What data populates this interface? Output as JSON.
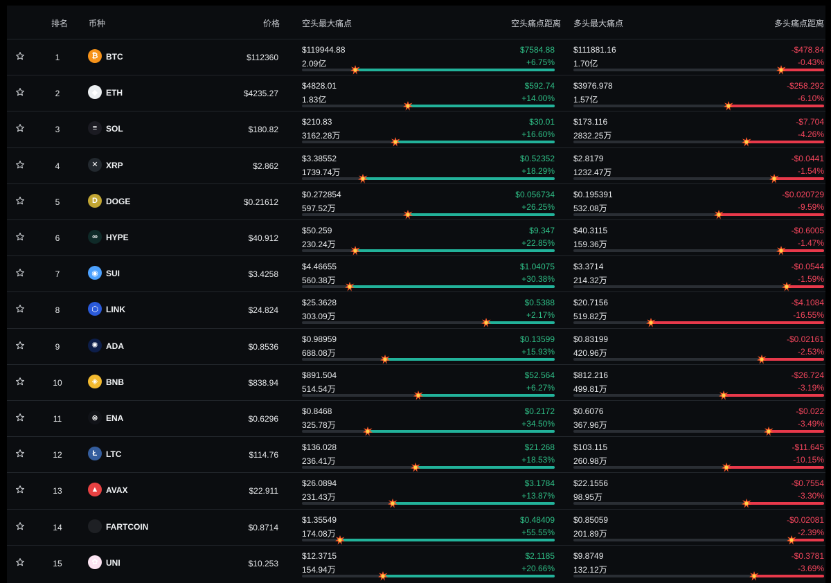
{
  "header": {
    "rank": "排名",
    "coin": "币种",
    "price": "价格",
    "short_max_pain": "空头最大痛点",
    "short_pain_distance": "空头痛点距离",
    "long_max_pain": "多头最大痛点",
    "long_pain_distance": "多头痛点距离"
  },
  "colors": {
    "positive": "#2ebd85",
    "negative": "#f6465d",
    "short_bar": "#22b29a",
    "long_bar": "#e8394b",
    "track": "#2a2e34",
    "background": "#0b0d10"
  },
  "rows": [
    {
      "rank": "1",
      "coin": "BTC",
      "icon": "bitcoin-icon",
      "icon_glyph": "₿",
      "icon_color": "#f7931a",
      "price": "$112360",
      "short_max": "$119944.88",
      "short_amt": "2.09亿",
      "short_dist": "$7584.88",
      "short_pct": "+6.75%",
      "short_fill": 0.79,
      "long_max": "$111881.16",
      "long_amt": "1.70亿",
      "long_dist": "-$478.84",
      "long_pct": "-0.43%",
      "long_fill": 0.17
    },
    {
      "rank": "2",
      "coin": "ETH",
      "icon": "ethereum-icon",
      "icon_glyph": "◆",
      "icon_color": "#eceff1",
      "price": "$4235.27",
      "short_max": "$4828.01",
      "short_amt": "1.83亿",
      "short_dist": "$592.74",
      "short_pct": "+14.00%",
      "short_fill": 0.58,
      "long_max": "$3976.978",
      "long_amt": "1.57亿",
      "long_dist": "-$258.292",
      "long_pct": "-6.10%",
      "long_fill": 0.38
    },
    {
      "rank": "3",
      "coin": "SOL",
      "icon": "solana-icon",
      "icon_glyph": "≡",
      "icon_color": "#1b1b22",
      "price": "$180.82",
      "short_max": "$210.83",
      "short_amt": "3162.28万",
      "short_dist": "$30.01",
      "short_pct": "+16.60%",
      "short_fill": 0.63,
      "long_max": "$173.116",
      "long_amt": "2832.25万",
      "long_dist": "-$7.704",
      "long_pct": "-4.26%",
      "long_fill": 0.31
    },
    {
      "rank": "4",
      "coin": "XRP",
      "icon": "xrp-icon",
      "icon_glyph": "✕",
      "icon_color": "#23292f",
      "price": "$2.862",
      "short_max": "$3.38552",
      "short_amt": "1739.74万",
      "short_dist": "$0.52352",
      "short_pct": "+18.29%",
      "short_fill": 0.76,
      "long_max": "$2.8179",
      "long_amt": "1232.47万",
      "long_dist": "-$0.0441",
      "long_pct": "-1.54%",
      "long_fill": 0.2
    },
    {
      "rank": "5",
      "coin": "DOGE",
      "icon": "dogecoin-icon",
      "icon_glyph": "D",
      "icon_color": "#c2a633",
      "price": "$0.21612",
      "short_max": "$0.272854",
      "short_amt": "597.52万",
      "short_dist": "$0.056734",
      "short_pct": "+26.25%",
      "short_fill": 0.58,
      "long_max": "$0.195391",
      "long_amt": "532.08万",
      "long_dist": "-$0.020729",
      "long_pct": "-9.59%",
      "long_fill": 0.42
    },
    {
      "rank": "6",
      "coin": "HYPE",
      "icon": "hyperliquid-icon",
      "icon_glyph": "∞",
      "icon_color": "#0f2a28",
      "price": "$40.912",
      "short_max": "$50.259",
      "short_amt": "230.24万",
      "short_dist": "$9.347",
      "short_pct": "+22.85%",
      "short_fill": 0.79,
      "long_max": "$40.3115",
      "long_amt": "159.36万",
      "long_dist": "-$0.6005",
      "long_pct": "-1.47%",
      "long_fill": 0.17
    },
    {
      "rank": "7",
      "coin": "SUI",
      "icon": "sui-icon",
      "icon_glyph": "◉",
      "icon_color": "#4da2ff",
      "price": "$3.4258",
      "short_max": "$4.46655",
      "short_amt": "560.38万",
      "short_dist": "$1.04075",
      "short_pct": "+30.38%",
      "short_fill": 0.81,
      "long_max": "$3.3714",
      "long_amt": "214.32万",
      "long_dist": "-$0.0544",
      "long_pct": "-1.59%",
      "long_fill": 0.15
    },
    {
      "rank": "8",
      "coin": "LINK",
      "icon": "chainlink-icon",
      "icon_glyph": "⬡",
      "icon_color": "#2a5ada",
      "price": "$24.824",
      "short_max": "$25.3628",
      "short_amt": "303.09万",
      "short_dist": "$0.5388",
      "short_pct": "+2.17%",
      "short_fill": 0.27,
      "long_max": "$20.7156",
      "long_amt": "519.82万",
      "long_dist": "-$4.1084",
      "long_pct": "-16.55%",
      "long_fill": 0.69
    },
    {
      "rank": "9",
      "coin": "ADA",
      "icon": "cardano-icon",
      "icon_glyph": "✺",
      "icon_color": "#0d1e4a",
      "price": "$0.8536",
      "short_max": "$0.98959",
      "short_amt": "688.08万",
      "short_dist": "$0.13599",
      "short_pct": "+15.93%",
      "short_fill": 0.67,
      "long_max": "$0.83199",
      "long_amt": "420.96万",
      "long_dist": "-$0.02161",
      "long_pct": "-2.53%",
      "long_fill": 0.25
    },
    {
      "rank": "10",
      "coin": "BNB",
      "icon": "bnb-icon",
      "icon_glyph": "◈",
      "icon_color": "#f3ba2f",
      "price": "$838.94",
      "short_max": "$891.504",
      "short_amt": "514.54万",
      "short_dist": "$52.564",
      "short_pct": "+6.27%",
      "short_fill": 0.54,
      "long_max": "$812.216",
      "long_amt": "499.81万",
      "long_dist": "-$26.724",
      "long_pct": "-3.19%",
      "long_fill": 0.4
    },
    {
      "rank": "11",
      "coin": "ENA",
      "icon": "ethena-icon",
      "icon_glyph": "⊗",
      "icon_color": "#111318",
      "price": "$0.6296",
      "short_max": "$0.8468",
      "short_amt": "325.78万",
      "short_dist": "$0.2172",
      "short_pct": "+34.50%",
      "short_fill": 0.74,
      "long_max": "$0.6076",
      "long_amt": "367.96万",
      "long_dist": "-$0.022",
      "long_pct": "-3.49%",
      "long_fill": 0.22
    },
    {
      "rank": "12",
      "coin": "LTC",
      "icon": "litecoin-icon",
      "icon_glyph": "Ł",
      "icon_color": "#345d9d",
      "price": "$114.76",
      "short_max": "$136.028",
      "short_amt": "236.41万",
      "short_dist": "$21.268",
      "short_pct": "+18.53%",
      "short_fill": 0.55,
      "long_max": "$103.115",
      "long_amt": "260.98万",
      "long_dist": "-$11.645",
      "long_pct": "-10.15%",
      "long_fill": 0.39
    },
    {
      "rank": "13",
      "coin": "AVAX",
      "icon": "avalanche-icon",
      "icon_glyph": "▲",
      "icon_color": "#e84142",
      "price": "$22.911",
      "short_max": "$26.0894",
      "short_amt": "231.43万",
      "short_dist": "$3.1784",
      "short_pct": "+13.87%",
      "short_fill": 0.64,
      "long_max": "$22.1556",
      "long_amt": "98.95万",
      "long_dist": "-$0.7554",
      "long_pct": "-3.30%",
      "long_fill": 0.31
    },
    {
      "rank": "14",
      "coin": "FARTCOIN",
      "icon": "fartcoin-icon",
      "icon_glyph": "",
      "icon_color": "#1e2024",
      "price": "$0.8714",
      "short_max": "$1.35549",
      "short_amt": "174.08万",
      "short_dist": "$0.48409",
      "short_pct": "+55.55%",
      "short_fill": 0.85,
      "long_max": "$0.85059",
      "long_amt": "201.89万",
      "long_dist": "-$0.02081",
      "long_pct": "-2.39%",
      "long_fill": 0.13
    },
    {
      "rank": "15",
      "coin": "UNI",
      "icon": "uniswap-icon",
      "icon_glyph": "✿",
      "icon_color": "#fce4f2",
      "price": "$10.253",
      "short_max": "$12.3715",
      "short_amt": "154.94万",
      "short_dist": "$2.1185",
      "short_pct": "+20.66%",
      "short_fill": 0.68,
      "long_max": "$9.8749",
      "long_amt": "132.12万",
      "long_dist": "-$0.3781",
      "long_pct": "-3.69%",
      "long_fill": 0.28
    }
  ]
}
